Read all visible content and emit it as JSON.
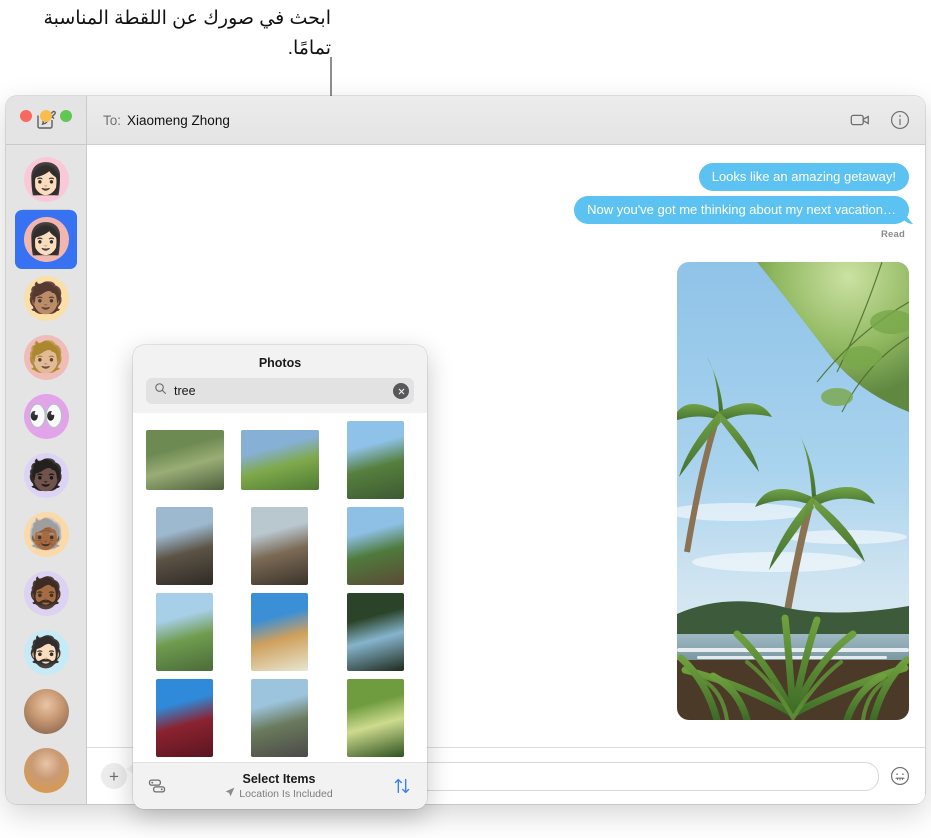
{
  "callout": {
    "text": "ابحث في صورك عن اللقطة المناسبة تمامًا."
  },
  "window": {
    "titlebar": {
      "to_label": "To:",
      "recipient": "Xiaomeng Zhong",
      "video_icon": "video-camera-icon",
      "info_icon": "info-circle-icon"
    },
    "traffic_lights": [
      "close",
      "minimize",
      "zoom"
    ]
  },
  "sidebar": {
    "compose_icon": "compose-pencil-icon",
    "conversations": [
      {
        "name": "conversation-1",
        "avatar": "memoji-woman-glasses",
        "bg": "#f9c9d8",
        "glyph": "👩🏻",
        "selected": false,
        "photo": false
      },
      {
        "name": "conversation-2",
        "avatar": "memoji-woman-bob",
        "bg": "#f2b6b0",
        "glyph": "👩🏻",
        "selected": true,
        "photo": false
      },
      {
        "name": "conversation-3",
        "avatar": "memoji-green-beanie",
        "bg": "#fbdfa8",
        "glyph": "🧑🏽",
        "selected": false,
        "photo": false
      },
      {
        "name": "conversation-4",
        "avatar": "memoji-glasses-brown-hair",
        "bg": "#f0bcb8",
        "glyph": "🧑🏼",
        "selected": false,
        "photo": false
      },
      {
        "name": "conversation-5",
        "avatar": "memoji-eyes",
        "bg": "#e2a3e8",
        "glyph": "👀",
        "selected": false,
        "photo": false
      },
      {
        "name": "conversation-6",
        "avatar": "memoji-curly-sunglasses",
        "bg": "#ddd4f5",
        "glyph": "🧑🏿",
        "selected": false,
        "photo": false
      },
      {
        "name": "conversation-7",
        "avatar": "memoji-gray-hair",
        "bg": "#fbd9a8",
        "glyph": "🧓🏾",
        "selected": false,
        "photo": false
      },
      {
        "name": "conversation-8",
        "avatar": "memoji-bucket-hat-beard",
        "bg": "#dcd2f2",
        "glyph": "🧔🏾",
        "selected": false,
        "photo": false
      },
      {
        "name": "conversation-9",
        "avatar": "memoji-beanie-beard",
        "bg": "#c6eaf6",
        "glyph": "🧔🏻",
        "selected": false,
        "photo": false
      },
      {
        "name": "conversation-10",
        "avatar": "photo-woman-short-hair",
        "bg": "#7a5c48",
        "glyph": "",
        "selected": false,
        "photo": true
      },
      {
        "name": "conversation-11",
        "avatar": "photo-person-orange",
        "bg": "#e09a3c",
        "glyph": "",
        "selected": false,
        "photo": true
      }
    ]
  },
  "transcript": {
    "messages": [
      {
        "text": "Looks like an amazing getaway!",
        "sender": "me",
        "tail": false
      },
      {
        "text": "Now you've got me thinking about my next vacation…",
        "sender": "me",
        "tail": true
      }
    ],
    "read_status": "Read",
    "attachment": {
      "name": "palm-trees-beach-photo",
      "description": "Palm trees and tropical foliage against blue sky above a coastline"
    }
  },
  "compose": {
    "plus_icon": "plus-icon",
    "input_placeholder": "",
    "input_value": "",
    "emoji_icon": "smiley-face-icon"
  },
  "photos_popover": {
    "title": "Photos",
    "search": {
      "icon": "magnifier-icon",
      "value": "tree",
      "placeholder": "Search",
      "clear_icon": "clear-circle-icon"
    },
    "grid": [
      {
        "name": "photo-forest-rocks-stream",
        "ratio": "landscape",
        "c1": "#6d8a52",
        "c2": "#9aad76",
        "c3": "#4c5f3c"
      },
      {
        "name": "photo-green-meadow-trees",
        "ratio": "landscape",
        "c1": "#87b0d6",
        "c2": "#7ea94b",
        "c3": "#4f7a33"
      },
      {
        "name": "photo-palm-over-water",
        "ratio": "portrait",
        "c1": "#8fc2e8",
        "c2": "#567f3e",
        "c3": "#3d5a33"
      },
      {
        "name": "photo-cliff-coast-waves",
        "ratio": "portrait",
        "c1": "#9db9cf",
        "c2": "#5c5346",
        "c3": "#2f2a24"
      },
      {
        "name": "photo-rocky-shore-surf",
        "ratio": "portrait",
        "c1": "#b9c7cf",
        "c2": "#7b6a55",
        "c3": "#3a332b"
      },
      {
        "name": "photo-river-reflection-trees",
        "ratio": "portrait",
        "c1": "#8ec0e6",
        "c2": "#4f7a3c",
        "c3": "#5b4a36"
      },
      {
        "name": "photo-palm-sky-plants",
        "ratio": "portrait",
        "c1": "#a8cfe8",
        "c2": "#6f9c4f",
        "c3": "#4a6b38"
      },
      {
        "name": "photo-dog-in-flowers",
        "ratio": "portrait",
        "c1": "#3b8fd6",
        "c2": "#cfa05c",
        "c3": "#e8e6d2"
      },
      {
        "name": "photo-tropical-path-ocean",
        "ratio": "portrait",
        "c1": "#2b4429",
        "c2": "#86b4cc",
        "c3": "#1e2a1c"
      },
      {
        "name": "photo-red-leaves-blue-sky",
        "ratio": "portrait",
        "c1": "#2f8ada",
        "c2": "#8b2230",
        "c3": "#5a1620"
      },
      {
        "name": "photo-black-sand-beach",
        "ratio": "portrait",
        "c1": "#9dc4dd",
        "c2": "#6a7a5c",
        "c3": "#4a4a48"
      },
      {
        "name": "photo-white-flower-buds",
        "ratio": "portrait",
        "c1": "#6f9c3f",
        "c2": "#cddb8e",
        "c3": "#2f5220"
      }
    ],
    "footer": {
      "library_icon": "photo-library-icon",
      "select_items_label": "Select Items",
      "location_icon": "location-arrow-icon",
      "location_label": "Location Is Included",
      "sort_icon": "sort-up-down-icon"
    }
  },
  "colors": {
    "bubble_blue": "#5cc2f2",
    "selection_blue": "#3672f2",
    "accent_blue": "#3b7ef2",
    "sidebar_bg": "#e4e4e4",
    "titlebar_bg": "#e8e8e8"
  }
}
